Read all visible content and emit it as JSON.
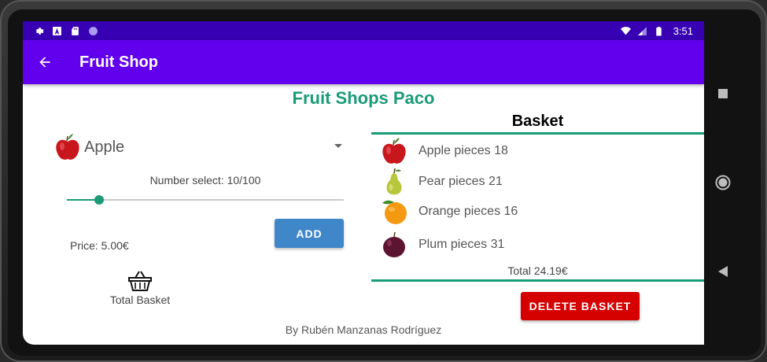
{
  "status_bar": {
    "time": "3:51",
    "left_icons": [
      "settings-icon",
      "a-icon",
      "sd-card-icon",
      "circle-icon"
    ],
    "right_icons": [
      "wifi-icon",
      "signal-icon",
      "battery-icon"
    ]
  },
  "app_bar": {
    "title": "Fruit Shop",
    "back_icon": "arrow-back-icon"
  },
  "shop": {
    "title": "Fruit Shops Paco"
  },
  "selector": {
    "selected_fruit": "Apple",
    "number_select": "Number select: 10/100",
    "slider_value": 10,
    "slider_max": 100,
    "price": "Price: 5.00€",
    "add_label": "ADD",
    "total_basket_label": "Total Basket"
  },
  "basket": {
    "heading": "Basket",
    "items": [
      {
        "fruit": "apple",
        "label": "Apple pieces 18"
      },
      {
        "fruit": "pear",
        "label": "Pear pieces 21"
      },
      {
        "fruit": "orange",
        "label": "Orange pieces 16"
      },
      {
        "fruit": "plum",
        "label": "Plum pieces 31"
      }
    ],
    "total": "Total 24.19€",
    "delete_label": "DELETE BASKET"
  },
  "footer": {
    "text": "By Rubén Manzanas Rodríguez"
  },
  "colors": {
    "status_bar": "#3700b3",
    "app_bar": "#6200ee",
    "accent": "#1a9b77",
    "add_button": "#3f87c8",
    "delete_button": "#d50000"
  }
}
